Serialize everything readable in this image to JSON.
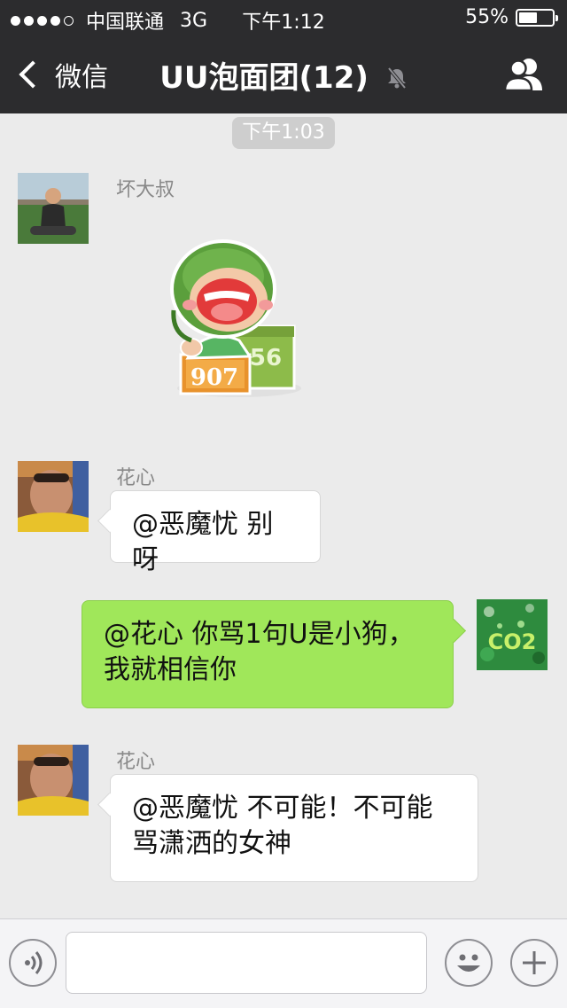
{
  "status_bar": {
    "carrier": "中国联通",
    "network": "3G",
    "time": "下午1:12",
    "battery": "55%",
    "battery_level": 0.55
  },
  "nav": {
    "back_label": "微信",
    "title": "UU泡面团(12)",
    "mute_icon": "bell-slash-icon",
    "contacts_icon": "group-contacts-icon"
  },
  "chat": {
    "timestamp": "下午1:03",
    "messages": [
      {
        "sender": "坏大叔",
        "type": "sticker",
        "sticker_labels": [
          "907",
          "56"
        ]
      },
      {
        "sender": "花心",
        "type": "text",
        "lines": [
          "@恶魔忧 别呀"
        ]
      },
      {
        "sender": "me",
        "type": "text",
        "lines": [
          "@花心 你骂1句U是小狗，",
          "我就相信你"
        ]
      },
      {
        "sender": "花心",
        "type": "text",
        "lines": [
          "@恶魔忧 不可能！不可能",
          "骂潇洒的女神"
        ]
      }
    ],
    "avatar_text": "CO2"
  },
  "input_bar": {
    "voice_icon": "voice-icon",
    "emoji_icon": "smiley-icon",
    "add_icon": "plus-icon",
    "text_value": ""
  },
  "colors": {
    "bar_bg": "#2c2c2e",
    "chat_bg": "#ebebeb",
    "outgoing_bubble": "#a0e75a",
    "incoming_bubble": "#ffffff"
  }
}
